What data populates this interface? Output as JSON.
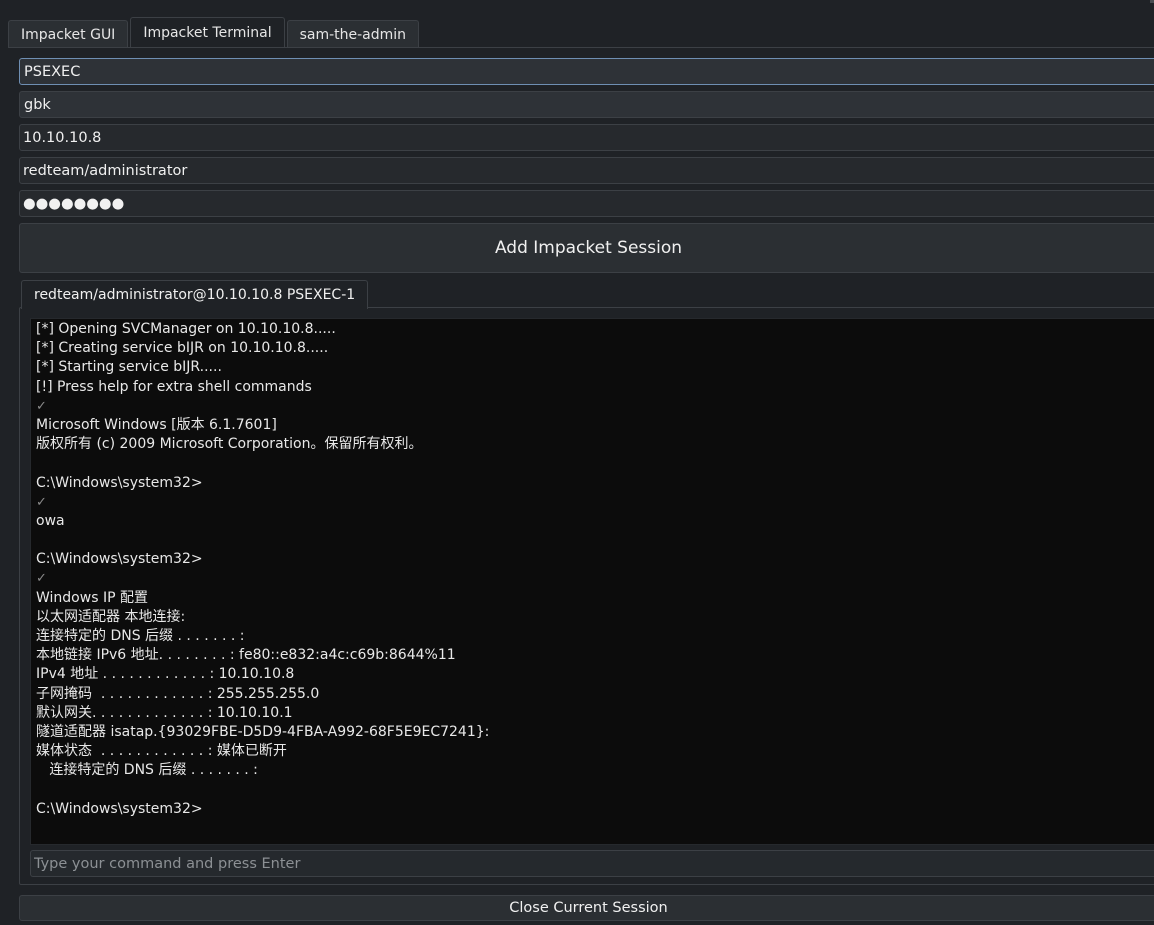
{
  "tabs": [
    {
      "label": "Impacket GUI"
    },
    {
      "label": "Impacket Terminal"
    },
    {
      "label": "sam-the-admin"
    }
  ],
  "active_tab": "Impacket Terminal",
  "form": {
    "method": "PSEXEC",
    "codec": "gbk",
    "target": "10.10.10.8",
    "username": "redteam/administrator",
    "password_masked": "●●●●●●●●"
  },
  "add_button_label": "Add Impacket Session",
  "session": {
    "tab_label": "redteam/administrator@10.10.10.8 PSEXEC-1",
    "terminal_lines": [
      "[*] Opening SVCManager on 10.10.10.8.....",
      "[*] Creating service bIJR on 10.10.10.8.....",
      "[*] Starting service bIJR.....",
      "[!] Press help for extra shell commands",
      "✓",
      "Microsoft Windows [版本 6.1.7601]",
      "版权所有 (c) 2009 Microsoft Corporation。保留所有权利。",
      "",
      "C:\\Windows\\system32>",
      "✓",
      "owa",
      "",
      "C:\\Windows\\system32>",
      "✓",
      "Windows IP 配置",
      "以太网适配器 本地连接:",
      "连接特定的 DNS 后缀 . . . . . . . :",
      "本地链接 IPv6 地址. . . . . . . . : fe80::e832:a4c:c69b:8644%11",
      "IPv4 地址 . . . . . . . . . . . . : 10.10.10.8",
      "子网掩码  . . . . . . . . . . . . : 255.255.255.0",
      "默认网关. . . . . . . . . . . . . : 10.10.10.1",
      "隧道适配器 isatap.{93029FBE-D5D9-4FBA-A992-68F5E9EC7241}:",
      "媒体状态  . . . . . . . . . . . . : 媒体已断开",
      "   连接特定的 DNS 后缀 . . . . . . . :",
      "",
      "C:\\Windows\\system32>"
    ],
    "command_placeholder": "Type your command and press Enter"
  },
  "close_button_label": "Close Current Session"
}
